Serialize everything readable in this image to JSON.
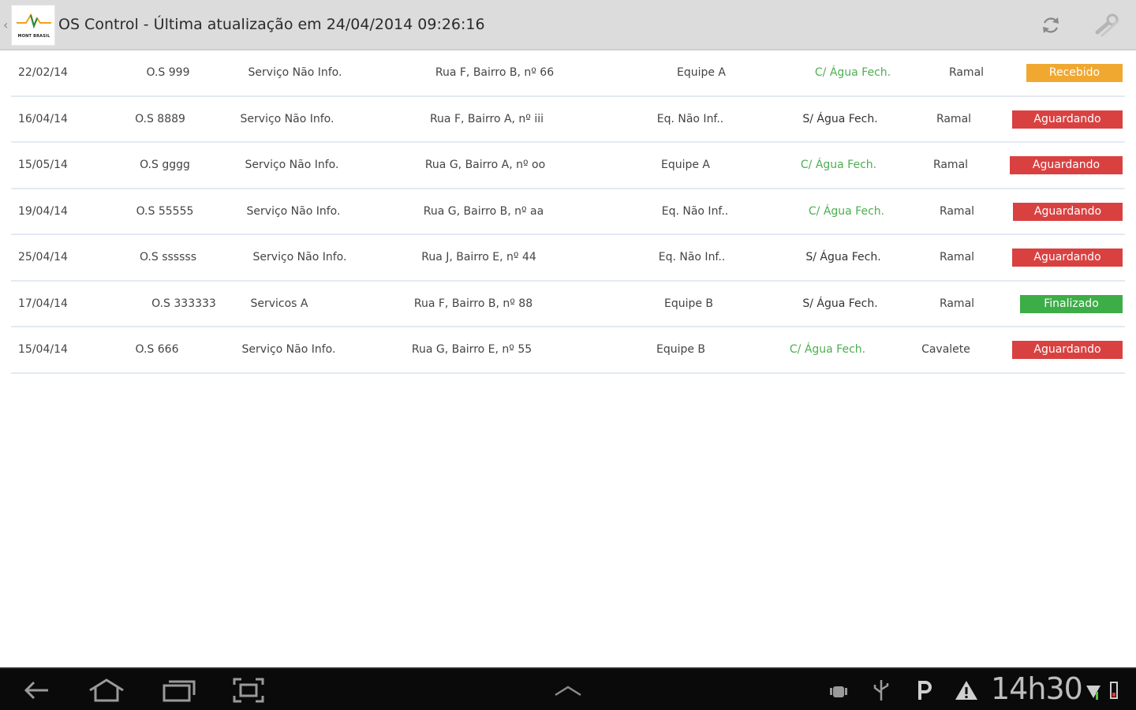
{
  "header": {
    "title": "OS Control - Última atualização em 24/04/2014 09:26:16",
    "logo_text": "MONT BRASIL",
    "refresh_icon": "refresh-icon",
    "settings_icon": "wrench-icon"
  },
  "orders": [
    {
      "date": "22/02/14",
      "os": "O.S 999",
      "service": "Serviço Não Info.",
      "address": "Rua F, Bairro B, nº 66",
      "team": "Equipe A",
      "water": "C/ Água Fech.",
      "water_color": "#4caf50",
      "type": "Ramal",
      "status": "Recebido",
      "status_color": "#f0a830"
    },
    {
      "date": "16/04/14",
      "os": "O.S 8889",
      "service": "Serviço Não Info.",
      "address": "Rua F, Bairro A, nº iii",
      "team": "Eq. Não Inf..",
      "water": "S/ Água Fech.",
      "water_color": "#333333",
      "type": "Ramal",
      "status": "Aguardando",
      "status_color": "#d94141"
    },
    {
      "date": "15/05/14",
      "os": "O.S gggg",
      "service": "Serviço Não Info.",
      "address": "Rua G, Bairro A, nº oo",
      "team": "Equipe A",
      "water": "C/ Água Fech.",
      "water_color": "#4caf50",
      "type": "Ramal",
      "status": "Aguardando",
      "status_color": "#d94141"
    },
    {
      "date": "19/04/14",
      "os": "O.S 55555",
      "service": "Serviço Não Info.",
      "address": "Rua G, Bairro B, nº aa",
      "team": "Eq. Não Inf..",
      "water": "C/ Água Fech.",
      "water_color": "#4caf50",
      "type": "Ramal",
      "status": "Aguardando",
      "status_color": "#d94141"
    },
    {
      "date": "25/04/14",
      "os": "O.S ssssss",
      "service": "Serviço Não Info.",
      "address": "Rua J, Bairro E, nº 44",
      "team": "Eq. Não Inf..",
      "water": "S/ Água Fech.",
      "water_color": "#333333",
      "type": "Ramal",
      "status": "Aguardando",
      "status_color": "#d94141"
    },
    {
      "date": "17/04/14",
      "os": "O.S 333333",
      "service": "Servicos A",
      "address": "Rua F, Bairro B, nº 88",
      "team": "Equipe B",
      "water": "S/ Água Fech.",
      "water_color": "#333333",
      "type": "Ramal",
      "status": "Finalizado",
      "status_color": "#3dad48"
    },
    {
      "date": "15/04/14",
      "os": "O.S 666",
      "service": "Serviço Não Info.",
      "address": "Rua G, Bairro E, nº 55",
      "team": "Equipe B",
      "water": "C/ Água Fech.",
      "water_color": "#4caf50",
      "type": "Cavalete",
      "status": "Aguardando",
      "status_color": "#d94141"
    }
  ],
  "system_bar": {
    "clock": "14h30",
    "nav_icons": [
      "back-icon",
      "home-icon",
      "recent-apps-icon",
      "screenshot-icon",
      "menu-up-icon"
    ],
    "status_icons": [
      "android-debug-icon",
      "usb-icon",
      "p-notification-icon",
      "warning-icon",
      "signal-icon",
      "battery-icon"
    ]
  }
}
